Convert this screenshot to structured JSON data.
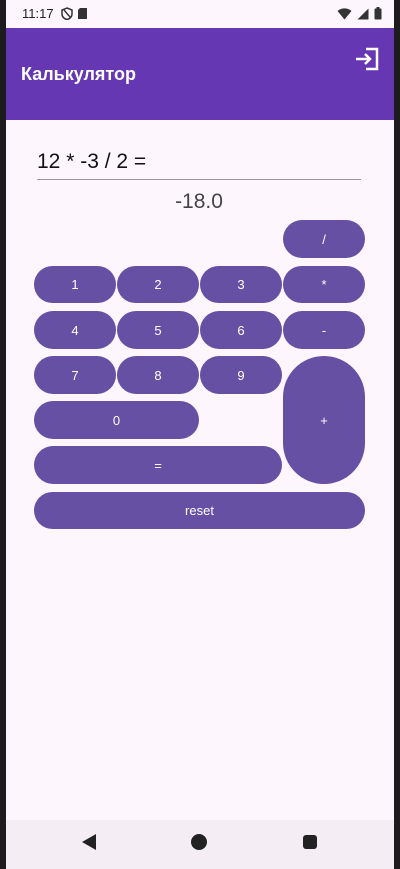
{
  "status_bar": {
    "time": "11:17",
    "icons": [
      "shield-icon",
      "sd-card-icon",
      "wifi-icon",
      "signal-icon",
      "battery-icon"
    ]
  },
  "app_bar": {
    "title": "Калькулятор",
    "exit_icon": "exit-icon"
  },
  "calculator": {
    "expression": "12 * -3 / 2 =",
    "result": "-18.0",
    "keys": {
      "divide": "/",
      "one": "1",
      "two": "2",
      "three": "3",
      "multiply": "*",
      "four": "4",
      "five": "5",
      "six": "6",
      "minus": "-",
      "seven": "7",
      "eight": "8",
      "nine": "9",
      "plus": "+",
      "zero": "0",
      "equals": "=",
      "reset": "reset"
    }
  },
  "nav_bar": {
    "icons": [
      "back-icon",
      "home-icon",
      "recents-icon"
    ]
  },
  "colors": {
    "app_bar": "#6537b3",
    "key": "#6650a4",
    "background": "#fdf6fd"
  }
}
